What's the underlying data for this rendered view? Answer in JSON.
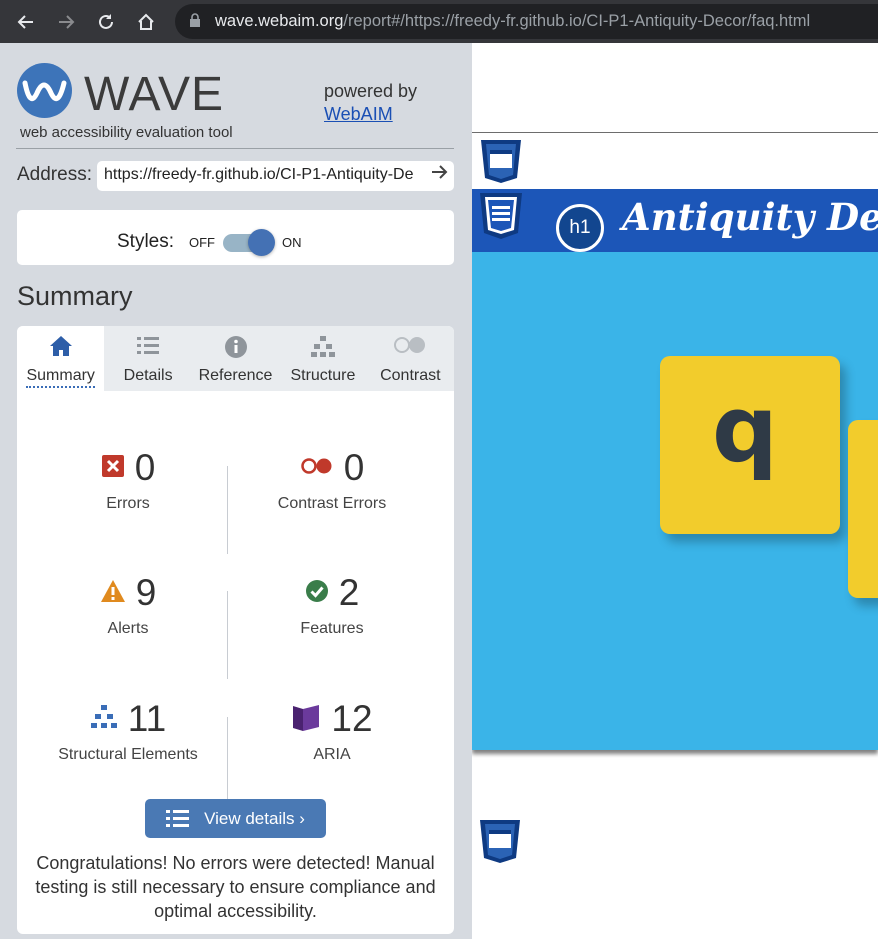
{
  "browser": {
    "url_host": "wave.webaim.org",
    "url_path": "/report#/https://freedy-fr.github.io/CI-P1-Antiquity-Decor/faq.html",
    "icons": [
      "back-icon",
      "forward-icon",
      "reload-icon",
      "home-icon",
      "lock-icon"
    ]
  },
  "logo": {
    "title": "WAVE",
    "subtitle": "web accessibility evaluation tool"
  },
  "powered": {
    "text": "powered by",
    "link": "WebAIM"
  },
  "address": {
    "label": "Address:",
    "value": "https://freedy-fr.github.io/CI-P1-Antiquity-De"
  },
  "styles": {
    "label": "Styles:",
    "off": "OFF",
    "on": "ON",
    "enabled": true
  },
  "summary": {
    "title": "Summary",
    "tabs": [
      {
        "label": "Summary",
        "icon": "home-icon",
        "active": true
      },
      {
        "label": "Details",
        "icon": "list-icon",
        "active": false
      },
      {
        "label": "Reference",
        "icon": "info-icon",
        "active": false
      },
      {
        "label": "Structure",
        "icon": "structure-icon",
        "active": false
      },
      {
        "label": "Contrast",
        "icon": "contrast-icon",
        "active": false
      }
    ],
    "errors": {
      "count": "0",
      "label": "Errors"
    },
    "contrast_errors": {
      "count": "0",
      "label": "Contrast Errors"
    },
    "alerts": {
      "count": "9",
      "label": "Alerts"
    },
    "features": {
      "count": "2",
      "label": "Features"
    },
    "structural": {
      "count": "11",
      "label": "Structural Elements"
    },
    "aria": {
      "count": "12",
      "label": "ARIA"
    },
    "view_details": "View details ›",
    "message": "Congratulations! No errors were detected! Manual testing is still necessary to ensure compliance and optimal accessibility."
  },
  "preview": {
    "heading_badge": "h1",
    "title": "Antiquity Decor",
    "tile_letter": "q"
  },
  "colors": {
    "chrome": "#35363a",
    "sidebar": "#d6dae0",
    "accent": "#4a79b4",
    "error_red": "#c0392b",
    "alert_orange": "#e08a1e",
    "feature_green": "#3a7d4a",
    "aria_purple": "#5b2d83",
    "preview_header": "#1c56b8",
    "preview_bg": "#3ab4e8",
    "tile": "#f2cc2c"
  }
}
